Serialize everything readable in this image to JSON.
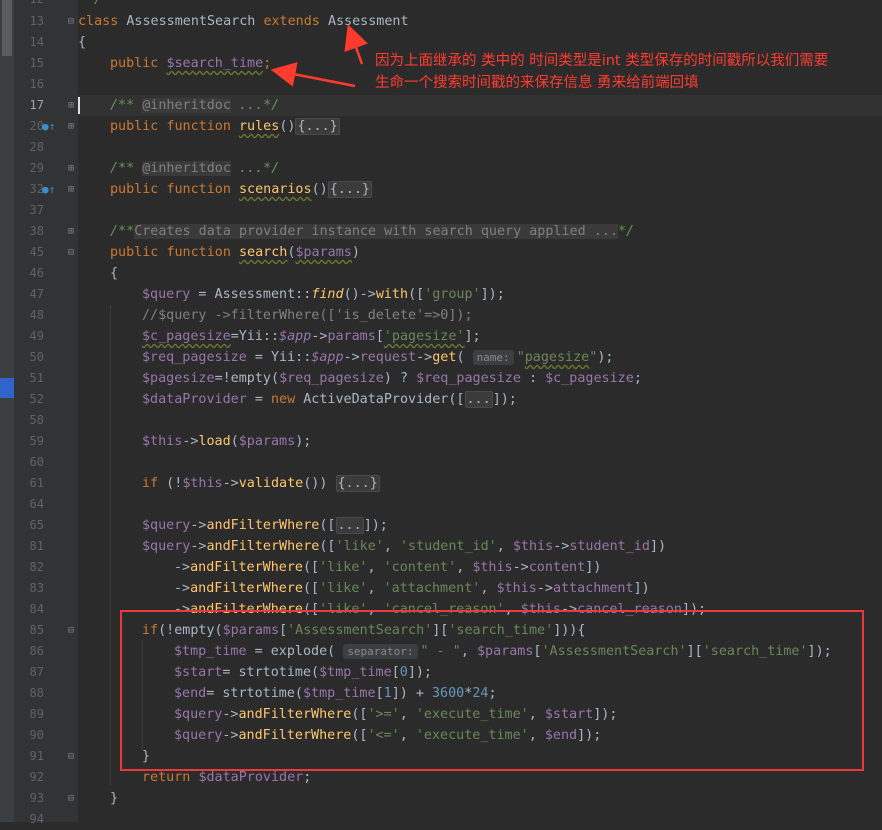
{
  "editor": {
    "language": "php",
    "current_line": "17",
    "lines": [
      {
        "n": "12",
        "text": " */"
      },
      {
        "n": "13",
        "class_kw": "class",
        "class_name": "AssessmentSearch",
        "extends_kw": "extends",
        "parent": "Assessment"
      },
      {
        "n": "14",
        "text": "{"
      },
      {
        "n": "15",
        "public_kw": "public",
        "var": "$search_time",
        "end": ";"
      },
      {
        "n": "16",
        "text": ""
      },
      {
        "n": "17",
        "doc_open": "/**",
        "tag": "@inheritdoc",
        "doc_rest": "...*/"
      },
      {
        "n": "20",
        "public_kw": "public",
        "function_kw": "function",
        "fn": "rules",
        "paren": "()",
        "fold": "{...}"
      },
      {
        "n": "28",
        "text": ""
      },
      {
        "n": "29",
        "doc_open": "/**",
        "tag": "@inheritdoc",
        "doc_rest": "...*/"
      },
      {
        "n": "32",
        "public_kw": "public",
        "function_kw": "function",
        "fn": "scenarios",
        "paren": "()",
        "fold": "{...}"
      },
      {
        "n": "37",
        "text": ""
      },
      {
        "n": "38",
        "doc_open": "/**",
        "doc_text": "Creates data provider instance with search query applied ...",
        "doc_rest": "*/"
      },
      {
        "n": "45",
        "public_kw": "public",
        "function_kw": "function",
        "fn": "search",
        "param": "$params"
      },
      {
        "n": "46",
        "text": "{"
      },
      {
        "n": "47",
        "code": "$query = Assessment::find()->with(['group']);"
      },
      {
        "n": "48",
        "code": "//$query ->filterWhere(['is_delete'=>0]);"
      },
      {
        "n": "49",
        "code": "$c_pagesize=Yii::$app->params['pagesize'];"
      },
      {
        "n": "50",
        "code": "$req_pagesize = Yii::$app->request->get(",
        "hint": "name:",
        "code2": "\"pagesize\");"
      },
      {
        "n": "51",
        "code": "$pagesize=!empty($req_pagesize) ? $req_pagesize : $c_pagesize;"
      },
      {
        "n": "52",
        "code": "$dataProvider = new ActiveDataProvider([...]);"
      },
      {
        "n": "58",
        "text": ""
      },
      {
        "n": "59",
        "code": "$this->load($params);"
      },
      {
        "n": "60",
        "text": ""
      },
      {
        "n": "61",
        "code": "if (!$this->validate()) {...}"
      },
      {
        "n": "64",
        "text": ""
      },
      {
        "n": "65",
        "code": "$query->andFilterWhere([...]);"
      },
      {
        "n": "81",
        "code": "$query->andFilterWhere(['like', 'student_id', $this->student_id])"
      },
      {
        "n": "82",
        "code": "->andFilterWhere(['like', 'content', $this->content])"
      },
      {
        "n": "83",
        "code": "->andFilterWhere(['like', 'attachment', $this->attachment])"
      },
      {
        "n": "84",
        "code": "->andFilterWhere(['like', 'cancel_reason', $this->cancel_reason]);"
      },
      {
        "n": "85",
        "code": "if(!empty($params['AssessmentSearch']['search_time'])){"
      },
      {
        "n": "86",
        "code": "$tmp_time = explode(",
        "hint": "separator:",
        "code2": "\" - \", $params['AssessmentSearch']['search_time']);"
      },
      {
        "n": "87",
        "code": "$start= strtotime($tmp_time[0]);"
      },
      {
        "n": "88",
        "code": "$end= strtotime($tmp_time[1]) + 3600*24;"
      },
      {
        "n": "89",
        "code": "$query->andFilterWhere(['>=', 'execute_time', $start]);"
      },
      {
        "n": "90",
        "code": "$query->andFilterWhere(['<=', 'execute_time', $end]);"
      },
      {
        "n": "91",
        "code": "}"
      },
      {
        "n": "92",
        "code": "return $dataProvider;"
      },
      {
        "n": "93",
        "code": "}"
      },
      {
        "n": "94",
        "text": ""
      }
    ]
  },
  "annotation": {
    "line1": "因为上面继承的 类中的 时间类型是int 类型保存的时间戳所以我们需要",
    "line2": "生命一个搜索时间戳的来保存信息 勇来给前端回填",
    "color": "#ff3b30"
  },
  "highlight_box_color": "#e83a3a"
}
